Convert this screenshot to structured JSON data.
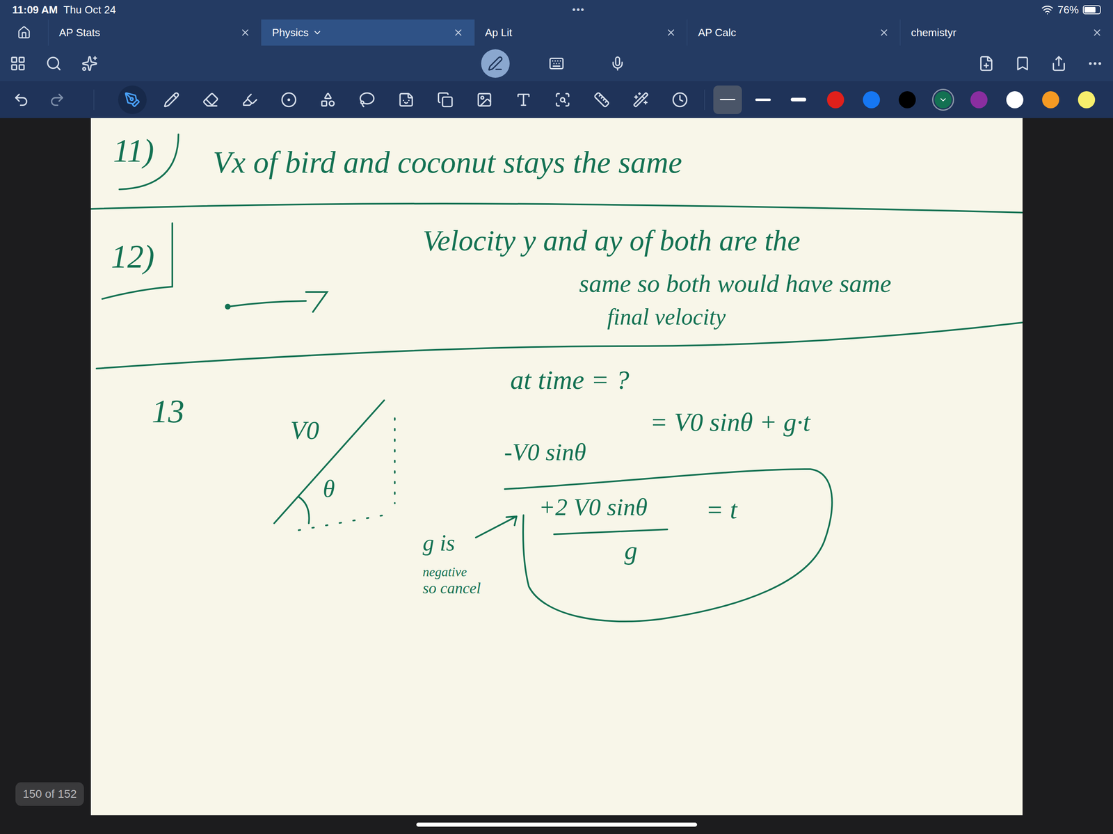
{
  "status_bar": {
    "time": "11:09 AM",
    "date": "Thu Oct 24",
    "dots": "•••",
    "battery": "76%",
    "battery_level": 0.76
  },
  "tabs": [
    {
      "label": "AP Stats",
      "selected": false
    },
    {
      "label": "Physics",
      "selected": true
    },
    {
      "label": "Ap Lit",
      "selected": false
    },
    {
      "label": "AP Calc",
      "selected": false
    },
    {
      "label": "chemistyr",
      "selected": false
    }
  ],
  "mode_buttons": [
    {
      "selected": true
    },
    {
      "selected": false
    },
    {
      "selected": false
    }
  ],
  "tools": [
    {
      "selected": true
    },
    {
      "selected": false
    },
    {
      "selected": false
    },
    {
      "selected": false
    },
    {
      "selected": false
    },
    {
      "selected": false
    },
    {
      "selected": false
    },
    {
      "selected": false
    },
    {
      "selected": false
    },
    {
      "selected": false
    },
    {
      "selected": false
    },
    {
      "selected": false
    },
    {
      "selected": false
    },
    {
      "selected": false
    },
    {
      "selected": false
    }
  ],
  "stroke_widths": [
    {
      "selected": true
    },
    {
      "selected": false
    },
    {
      "selected": false
    }
  ],
  "colors": [
    {
      "color": "#e0201b",
      "selected": false
    },
    {
      "color": "#1677f2",
      "selected": false
    },
    {
      "color": "#000000",
      "selected": false
    },
    {
      "color": "#137152",
      "selected": true
    },
    {
      "color": "#8a2ea0",
      "selected": false
    },
    {
      "color": "#ffffff",
      "selected": false
    },
    {
      "color": "#f59a23",
      "selected": false
    },
    {
      "color": "#f7ef6c",
      "selected": false
    }
  ],
  "page_counter": "150 of 152",
  "notes": [
    {
      "text": "11)"
    },
    {
      "text": "Vx of bird and coconut stays the same"
    },
    {
      "text": "12)"
    },
    {
      "text": "Velocity y and ay of both are the"
    },
    {
      "text": "same so both would have same"
    },
    {
      "text": "final velocity"
    },
    {
      "text": "13"
    },
    {
      "text": "at time = ?"
    },
    {
      "text": "V0"
    },
    {
      "text": "θ"
    },
    {
      "text": "-V0 sinθ"
    },
    {
      "text": "= V0 sinθ + g·t"
    },
    {
      "text": "+2 V0 sinθ"
    },
    {
      "text": "= t"
    },
    {
      "text": "g"
    },
    {
      "text": "g is"
    },
    {
      "text": "negative"
    },
    {
      "text": "so cancel"
    }
  ]
}
